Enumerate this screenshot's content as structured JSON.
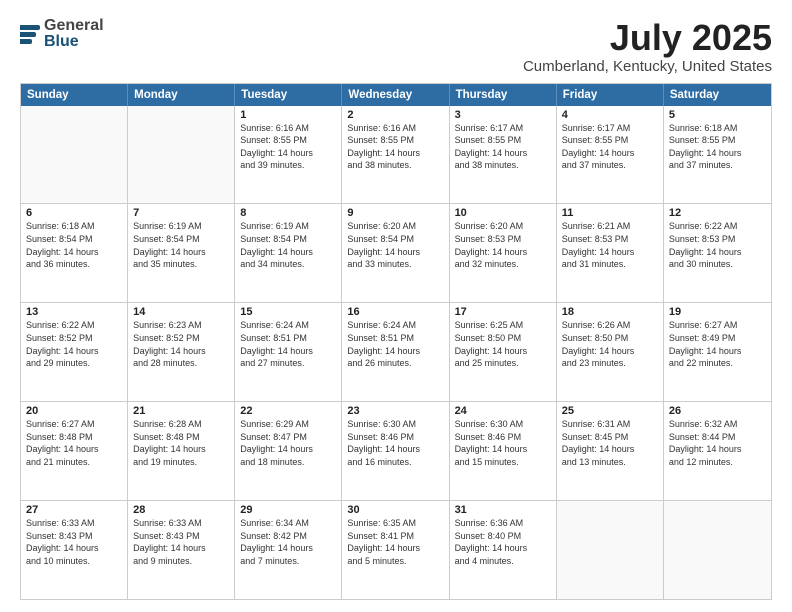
{
  "header": {
    "logo_general": "General",
    "logo_blue": "Blue",
    "title": "July 2025",
    "subtitle": "Cumberland, Kentucky, United States"
  },
  "calendar": {
    "weekdays": [
      "Sunday",
      "Monday",
      "Tuesday",
      "Wednesday",
      "Thursday",
      "Friday",
      "Saturday"
    ],
    "weeks": [
      [
        {
          "day": "",
          "empty": true,
          "detail": ""
        },
        {
          "day": "",
          "empty": true,
          "detail": ""
        },
        {
          "day": "1",
          "detail": "Sunrise: 6:16 AM\nSunset: 8:55 PM\nDaylight: 14 hours\nand 39 minutes."
        },
        {
          "day": "2",
          "detail": "Sunrise: 6:16 AM\nSunset: 8:55 PM\nDaylight: 14 hours\nand 38 minutes."
        },
        {
          "day": "3",
          "detail": "Sunrise: 6:17 AM\nSunset: 8:55 PM\nDaylight: 14 hours\nand 38 minutes."
        },
        {
          "day": "4",
          "detail": "Sunrise: 6:17 AM\nSunset: 8:55 PM\nDaylight: 14 hours\nand 37 minutes."
        },
        {
          "day": "5",
          "detail": "Sunrise: 6:18 AM\nSunset: 8:55 PM\nDaylight: 14 hours\nand 37 minutes."
        }
      ],
      [
        {
          "day": "6",
          "detail": "Sunrise: 6:18 AM\nSunset: 8:54 PM\nDaylight: 14 hours\nand 36 minutes."
        },
        {
          "day": "7",
          "detail": "Sunrise: 6:19 AM\nSunset: 8:54 PM\nDaylight: 14 hours\nand 35 minutes."
        },
        {
          "day": "8",
          "detail": "Sunrise: 6:19 AM\nSunset: 8:54 PM\nDaylight: 14 hours\nand 34 minutes."
        },
        {
          "day": "9",
          "detail": "Sunrise: 6:20 AM\nSunset: 8:54 PM\nDaylight: 14 hours\nand 33 minutes."
        },
        {
          "day": "10",
          "detail": "Sunrise: 6:20 AM\nSunset: 8:53 PM\nDaylight: 14 hours\nand 32 minutes."
        },
        {
          "day": "11",
          "detail": "Sunrise: 6:21 AM\nSunset: 8:53 PM\nDaylight: 14 hours\nand 31 minutes."
        },
        {
          "day": "12",
          "detail": "Sunrise: 6:22 AM\nSunset: 8:53 PM\nDaylight: 14 hours\nand 30 minutes."
        }
      ],
      [
        {
          "day": "13",
          "detail": "Sunrise: 6:22 AM\nSunset: 8:52 PM\nDaylight: 14 hours\nand 29 minutes."
        },
        {
          "day": "14",
          "detail": "Sunrise: 6:23 AM\nSunset: 8:52 PM\nDaylight: 14 hours\nand 28 minutes."
        },
        {
          "day": "15",
          "detail": "Sunrise: 6:24 AM\nSunset: 8:51 PM\nDaylight: 14 hours\nand 27 minutes."
        },
        {
          "day": "16",
          "detail": "Sunrise: 6:24 AM\nSunset: 8:51 PM\nDaylight: 14 hours\nand 26 minutes."
        },
        {
          "day": "17",
          "detail": "Sunrise: 6:25 AM\nSunset: 8:50 PM\nDaylight: 14 hours\nand 25 minutes."
        },
        {
          "day": "18",
          "detail": "Sunrise: 6:26 AM\nSunset: 8:50 PM\nDaylight: 14 hours\nand 23 minutes."
        },
        {
          "day": "19",
          "detail": "Sunrise: 6:27 AM\nSunset: 8:49 PM\nDaylight: 14 hours\nand 22 minutes."
        }
      ],
      [
        {
          "day": "20",
          "detail": "Sunrise: 6:27 AM\nSunset: 8:48 PM\nDaylight: 14 hours\nand 21 minutes."
        },
        {
          "day": "21",
          "detail": "Sunrise: 6:28 AM\nSunset: 8:48 PM\nDaylight: 14 hours\nand 19 minutes."
        },
        {
          "day": "22",
          "detail": "Sunrise: 6:29 AM\nSunset: 8:47 PM\nDaylight: 14 hours\nand 18 minutes."
        },
        {
          "day": "23",
          "detail": "Sunrise: 6:30 AM\nSunset: 8:46 PM\nDaylight: 14 hours\nand 16 minutes."
        },
        {
          "day": "24",
          "detail": "Sunrise: 6:30 AM\nSunset: 8:46 PM\nDaylight: 14 hours\nand 15 minutes."
        },
        {
          "day": "25",
          "detail": "Sunrise: 6:31 AM\nSunset: 8:45 PM\nDaylight: 14 hours\nand 13 minutes."
        },
        {
          "day": "26",
          "detail": "Sunrise: 6:32 AM\nSunset: 8:44 PM\nDaylight: 14 hours\nand 12 minutes."
        }
      ],
      [
        {
          "day": "27",
          "detail": "Sunrise: 6:33 AM\nSunset: 8:43 PM\nDaylight: 14 hours\nand 10 minutes."
        },
        {
          "day": "28",
          "detail": "Sunrise: 6:33 AM\nSunset: 8:43 PM\nDaylight: 14 hours\nand 9 minutes."
        },
        {
          "day": "29",
          "detail": "Sunrise: 6:34 AM\nSunset: 8:42 PM\nDaylight: 14 hours\nand 7 minutes."
        },
        {
          "day": "30",
          "detail": "Sunrise: 6:35 AM\nSunset: 8:41 PM\nDaylight: 14 hours\nand 5 minutes."
        },
        {
          "day": "31",
          "detail": "Sunrise: 6:36 AM\nSunset: 8:40 PM\nDaylight: 14 hours\nand 4 minutes."
        },
        {
          "day": "",
          "empty": true,
          "detail": ""
        },
        {
          "day": "",
          "empty": true,
          "detail": ""
        }
      ]
    ]
  }
}
